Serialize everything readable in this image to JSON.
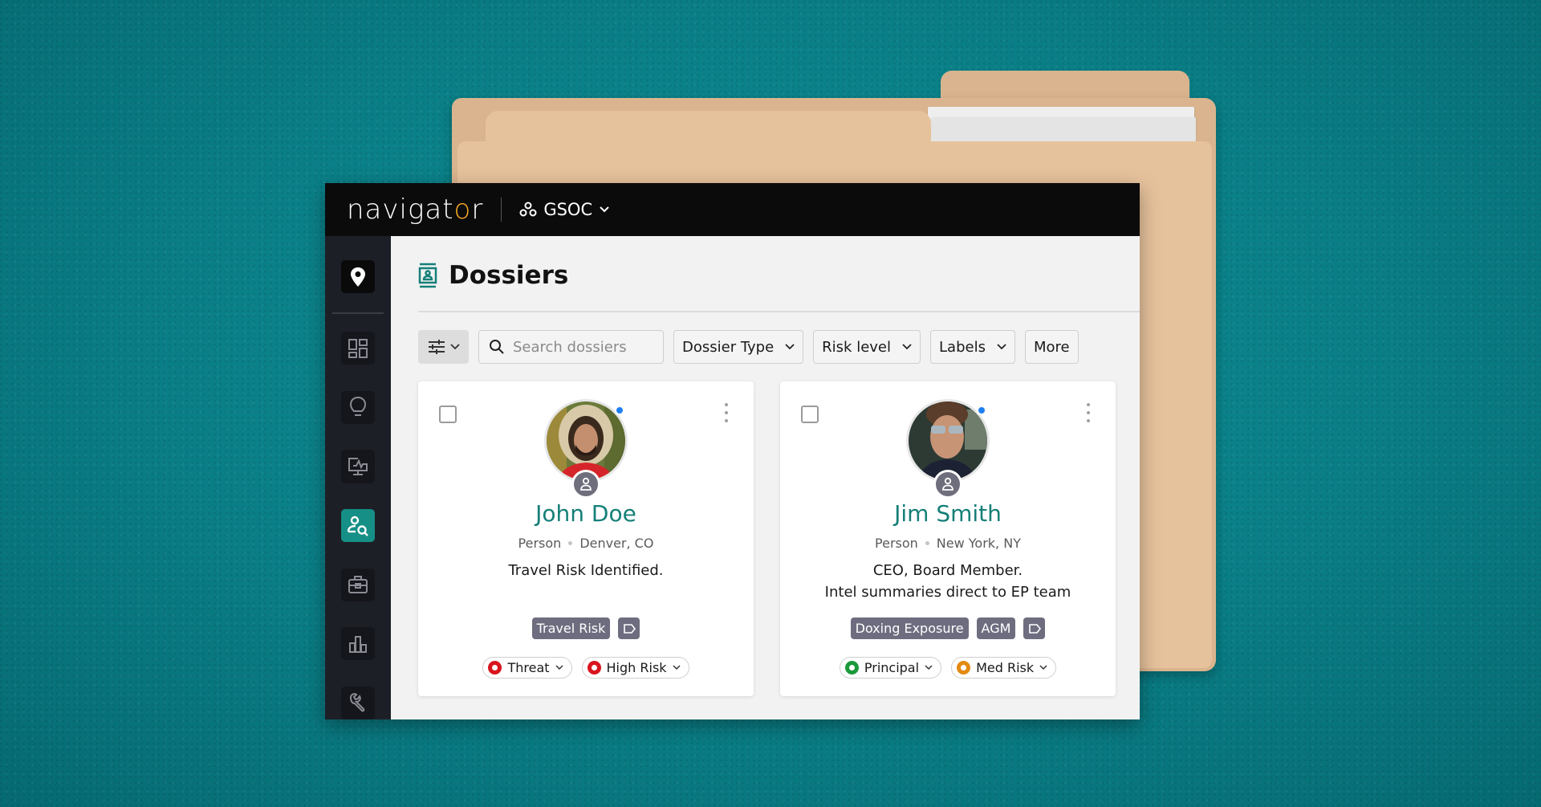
{
  "app": {
    "name": "navigator",
    "workspace": "GSOC"
  },
  "colors": {
    "accent": "#157f78",
    "brand_pin": "#f5a623",
    "threat": "#d9141e",
    "high_risk": "#d9141e",
    "principal": "#1a9a3a",
    "med_risk": "#e38a12",
    "online": "#1f7ff0",
    "label_chip": "#6e6d80"
  },
  "sidebar": {
    "items": [
      {
        "name": "home",
        "icon": "map-pin-icon"
      },
      {
        "name": "dashboard",
        "icon": "dashboard-grid-icon"
      },
      {
        "name": "insights",
        "icon": "lightbulb-icon"
      },
      {
        "name": "monitoring",
        "icon": "monitor-pulse-icon"
      },
      {
        "name": "dossiers",
        "icon": "person-search-icon",
        "active": true
      },
      {
        "name": "cases",
        "icon": "briefcase-icon"
      },
      {
        "name": "analytics",
        "icon": "bar-chart-icon"
      },
      {
        "name": "tools",
        "icon": "wrench-icon"
      }
    ]
  },
  "page": {
    "title": "Dossiers",
    "icon": "dossier-icon"
  },
  "toolbar": {
    "filter_icon": "sliders-icon",
    "search_placeholder": "Search dossiers",
    "search_value": "",
    "dropdowns": [
      "Dossier Type",
      "Risk level",
      "Labels"
    ],
    "more_label": "More"
  },
  "cards": [
    {
      "name": "John Doe",
      "type": "Person",
      "location": "Denver, CO",
      "description_lines": [
        "Travel Risk Identified."
      ],
      "labels": [
        "Travel Risk"
      ],
      "online": true,
      "pills": [
        {
          "label": "Threat",
          "color": "#d9141e"
        },
        {
          "label": "High Risk",
          "color": "#d9141e"
        }
      ]
    },
    {
      "name": "Jim Smith",
      "type": "Person",
      "location": "New York, NY",
      "description_lines": [
        "CEO, Board Member.",
        "Intel summaries direct to EP team"
      ],
      "labels": [
        "Doxing Exposure",
        "AGM"
      ],
      "online": true,
      "pills": [
        {
          "label": "Principal",
          "color": "#1a9a3a"
        },
        {
          "label": "Med Risk",
          "color": "#e38a12"
        }
      ]
    }
  ]
}
